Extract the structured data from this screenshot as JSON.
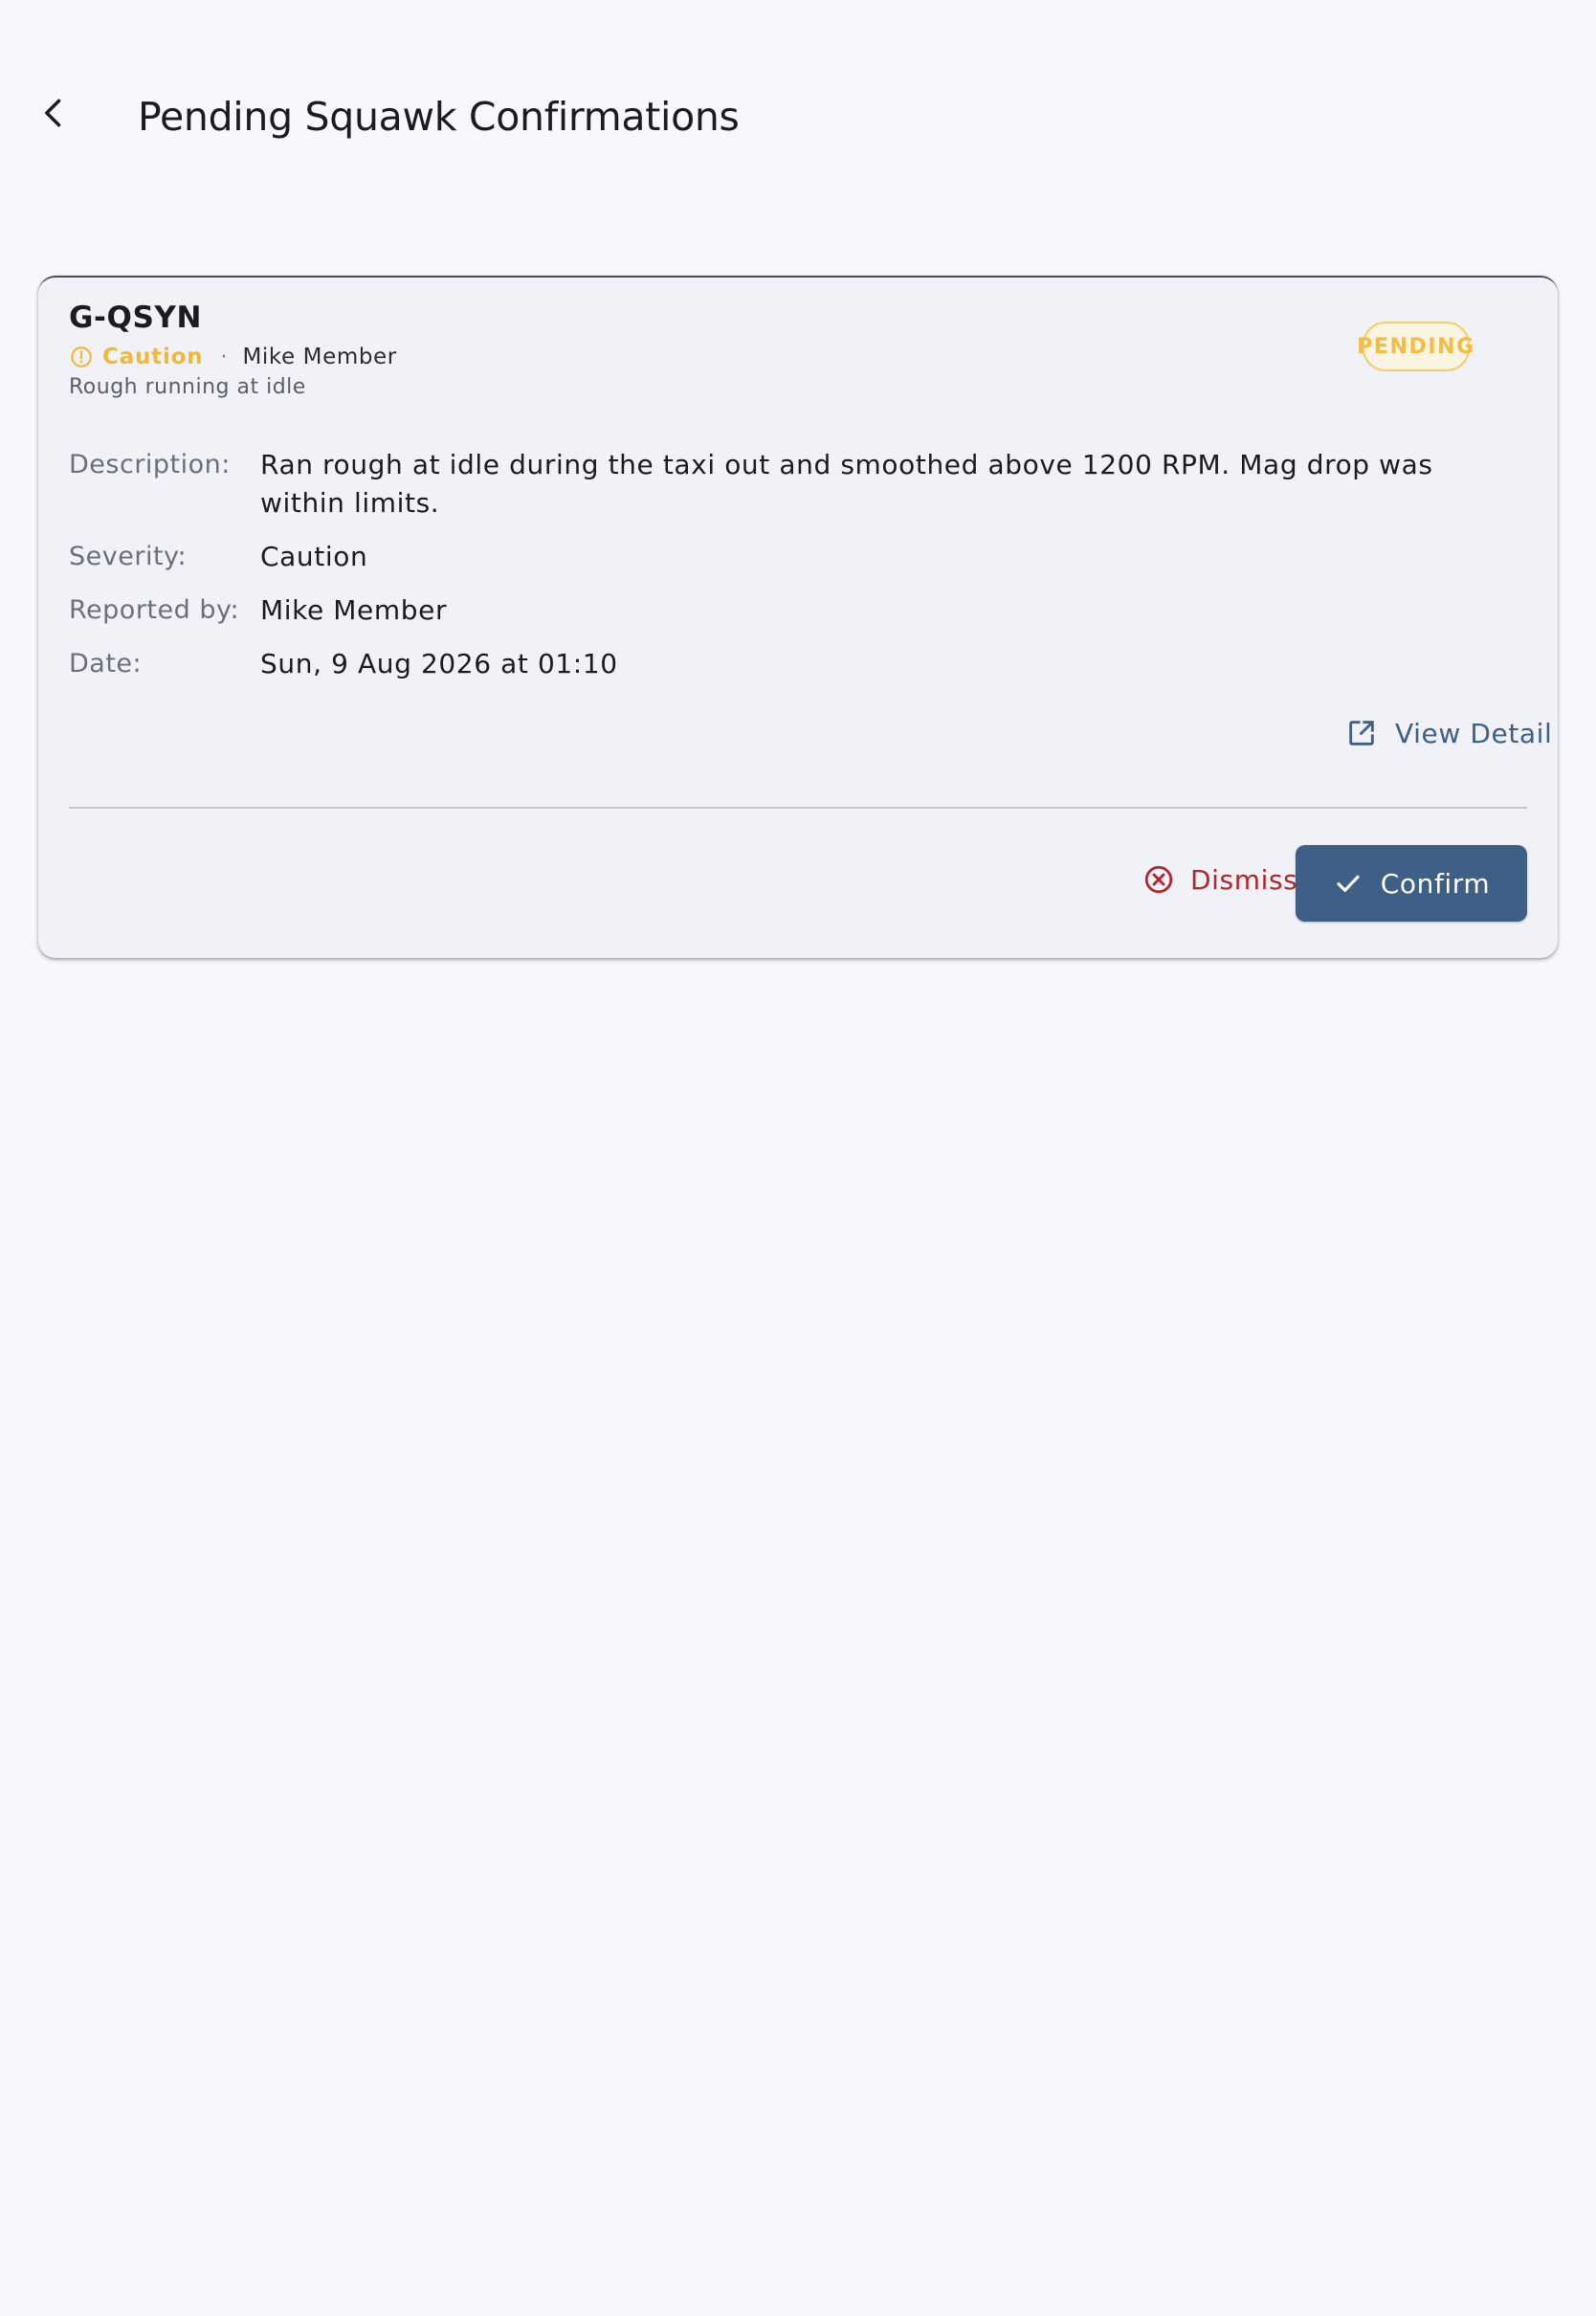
{
  "app_bar": {
    "title": "Pending Squawk Confirmations",
    "back_icon": "chevron-left-icon"
  },
  "squawk": {
    "aircraft": "G-QSYN",
    "severity": "Caution",
    "severity_icon": "caution-circle-icon",
    "reporter": "Mike Member",
    "separator": "·",
    "summary": "Rough running at idle",
    "status": "PENDING",
    "details": [
      {
        "label": "Description:",
        "value": "Ran rough at idle during the taxi out and smoothed above 1200 RPM. Mag drop was within limits."
      },
      {
        "label": "Severity:",
        "value": "Caution"
      },
      {
        "label": "Reported by:",
        "value": "Mike Member"
      },
      {
        "label": "Date:",
        "value": "Sun, 9 Aug 2026 at 01:10"
      }
    ],
    "view_detail_label": "View Detail",
    "view_detail_icon": "open-in-new-icon"
  },
  "actions": {
    "dismiss_label": "Dismiss",
    "dismiss_icon": "cancel-circle-icon",
    "confirm_label": "Confirm",
    "confirm_icon": "check-icon"
  },
  "colors": {
    "background": "#f7f8fc",
    "card": "#f1f2f7",
    "primary": "#3e5f86",
    "caution": "#f0b93a",
    "danger": "#b3262d"
  }
}
